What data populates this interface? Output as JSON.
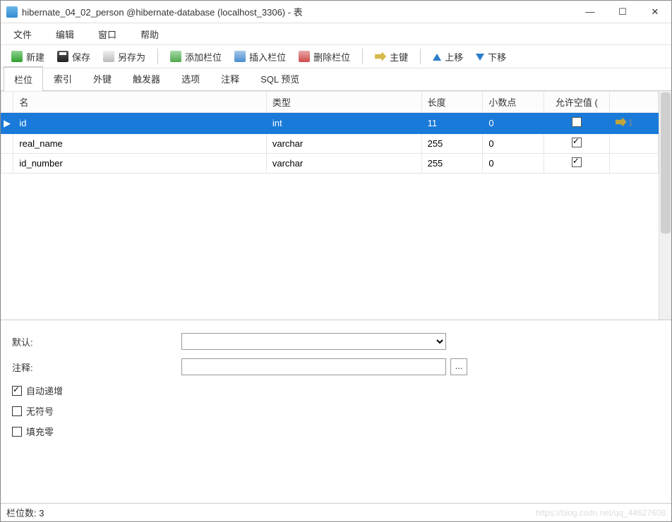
{
  "window": {
    "title": "hibernate_04_02_person @hibernate-database (localhost_3306) - 表"
  },
  "menu": {
    "file": "文件",
    "edit": "编辑",
    "window": "窗口",
    "help": "帮助"
  },
  "toolbar": {
    "new": "新建",
    "save": "保存",
    "saveas": "另存为",
    "addcol": "添加栏位",
    "inscol": "插入栏位",
    "delcol": "删除栏位",
    "primarykey": "主键",
    "moveup": "上移",
    "movedown": "下移"
  },
  "tabs": {
    "fields": "栏位",
    "indexes": "索引",
    "foreign": "外键",
    "triggers": "触发器",
    "options": "选项",
    "comment": "注释",
    "sqlpreview": "SQL 预览"
  },
  "columns": {
    "name": "名",
    "type": "类型",
    "length": "长度",
    "decimals": "小数点",
    "nullable": "允许空值 ("
  },
  "rows": [
    {
      "name": "id",
      "type": "int",
      "length": "11",
      "decimals": "0",
      "nullable": false,
      "pk": "1",
      "selected": true
    },
    {
      "name": "real_name",
      "type": "varchar",
      "length": "255",
      "decimals": "0",
      "nullable": true,
      "pk": "",
      "selected": false
    },
    {
      "name": "id_number",
      "type": "varchar",
      "length": "255",
      "decimals": "0",
      "nullable": true,
      "pk": "",
      "selected": false
    }
  ],
  "props": {
    "default_label": "默认:",
    "default_value": "",
    "comment_label": "注释:",
    "comment_value": "",
    "autoinc_label": "自动递增",
    "autoinc": true,
    "unsigned_label": "无符号",
    "unsigned": false,
    "zerofill_label": "填充零",
    "zerofill": false
  },
  "status": {
    "count_label": "栏位数: 3",
    "watermark": "https://blog.csdn.net/qq_44627608"
  }
}
